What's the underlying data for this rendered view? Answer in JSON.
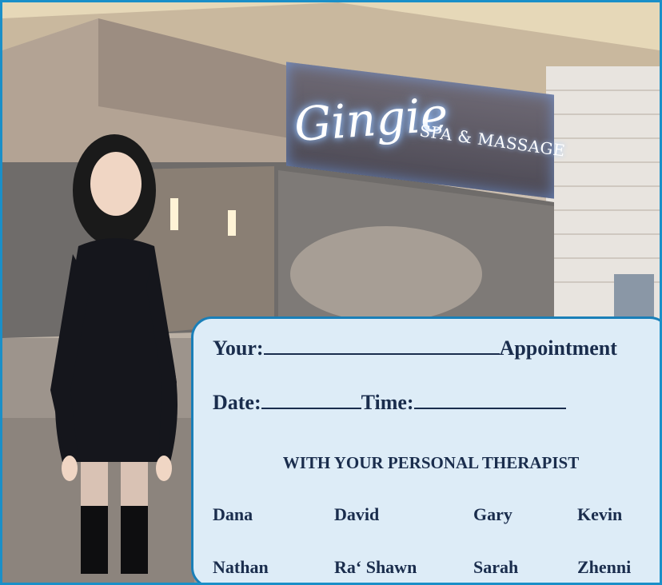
{
  "storefront": {
    "sign_script": "Gingie",
    "sign_sub": "SPA & MASSAGE"
  },
  "card": {
    "your_label": "Your:",
    "appointment_label": "Appointment",
    "date_label": "Date:",
    "time_label": "Time:",
    "heading": "WITH YOUR PERSONAL THERAPIST",
    "therapists": [
      "Dana",
      "David",
      "Gary",
      "Kevin",
      "Nathan",
      "Ra‘ Shawn",
      "Sarah",
      "Zhenni"
    ]
  },
  "colors": {
    "frame_border": "#1a8fc8",
    "card_bg": "#ddecf7",
    "card_border": "#1a7fb8",
    "text": "#1a2d4d"
  }
}
